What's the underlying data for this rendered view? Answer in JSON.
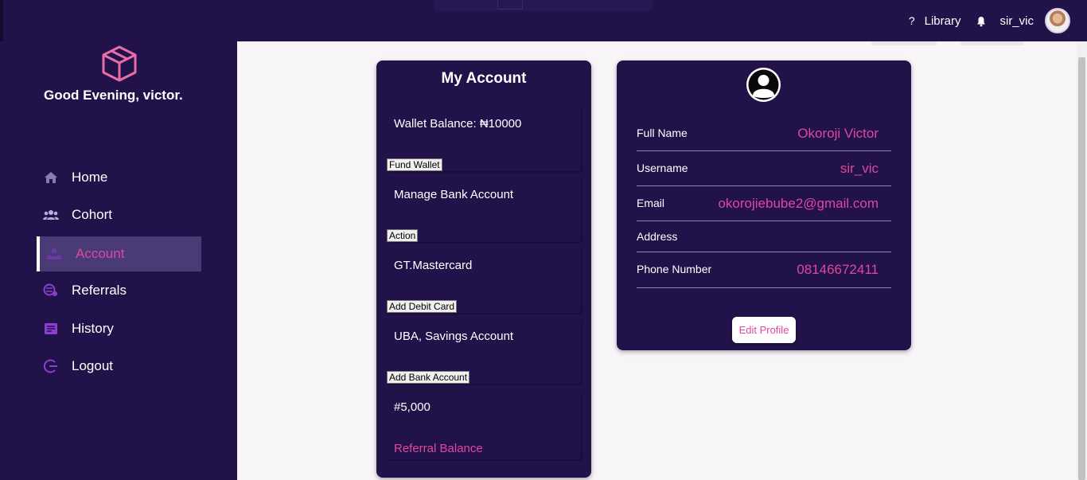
{
  "topbar": {
    "help_icon": "?",
    "library_label": "Library",
    "bell_icon": "bell-icon",
    "username": "sir_vic",
    "avatar_icon": "user-photo"
  },
  "sidebar": {
    "logo_icon": "cube-icon",
    "greeting": "Good Evening, victor.",
    "items": [
      {
        "label": "Home",
        "icon": "home-icon",
        "active": false
      },
      {
        "label": "Cohort",
        "icon": "group-icon",
        "active": false
      },
      {
        "label": "Account",
        "icon": "account-icon",
        "active": true
      },
      {
        "label": "Referrals",
        "icon": "referrals-icon",
        "active": false
      },
      {
        "label": "History",
        "icon": "history-icon",
        "active": false
      },
      {
        "label": "Logout",
        "icon": "logout-icon",
        "active": false
      }
    ]
  },
  "account": {
    "title": "My Account",
    "wallet_balance": "Wallet Balance: ₦10000",
    "fund_wallet_button": "Fund Wallet",
    "manage_bank": "Manage Bank Account",
    "action_button": "Action",
    "card_name": "GT.Mastercard",
    "add_debit_card_button": "Add Debit Card",
    "bank_account": "UBA, Savings Account",
    "add_bank_account_button": "Add Bank Account",
    "referral_amount": "#5,000",
    "referral_label": "Referral Balance"
  },
  "profile": {
    "avatar_icon": "user-avatar-icon",
    "full_name_label": "Full Name",
    "full_name": "Okoroji Victor",
    "username_label": "Username",
    "username": "sir_vic",
    "email_label": "Email",
    "email": "okorojiebube2@gmail.com",
    "address_label": "Address",
    "address": "",
    "phone_label": "Phone Number",
    "phone": "08146672411",
    "edit_button": "Edit Profile"
  },
  "colors": {
    "background": "#22124a",
    "accent": "#e0479e",
    "main_bg": "#f7f5f8",
    "active_nav": "#4a3a76",
    "icon_purple": "#8b3fd1"
  }
}
